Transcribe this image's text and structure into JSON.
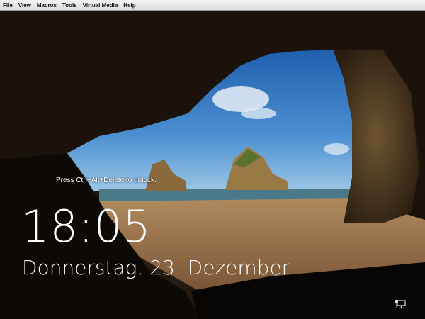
{
  "menubar": {
    "items": [
      "File",
      "View",
      "Macros",
      "Tools",
      "Virtual Media",
      "Help"
    ]
  },
  "lockscreen": {
    "hint": "Press Ctrl+Alt+Delete to unlock.",
    "time": "18:05",
    "date": "Donnerstag, 23. Dezember",
    "network_icon": "network-monitor-icon"
  }
}
